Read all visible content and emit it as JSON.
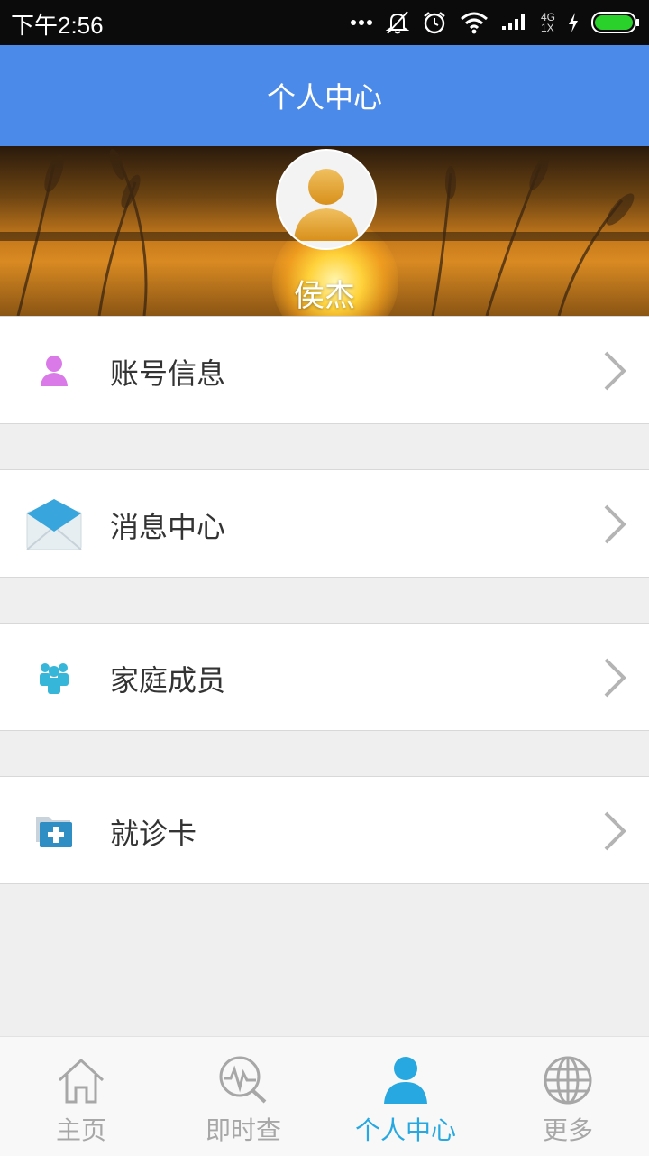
{
  "status_bar": {
    "time": "下午2:56",
    "network_top": "4G",
    "network_bottom": "1X"
  },
  "header": {
    "title": "个人中心"
  },
  "profile": {
    "name": "侯杰"
  },
  "menu": [
    {
      "label": "账号信息",
      "icon": "user-icon"
    },
    {
      "label": "消息中心",
      "icon": "envelope-icon"
    },
    {
      "label": "家庭成员",
      "icon": "family-icon"
    },
    {
      "label": "就诊卡",
      "icon": "medical-folder-icon"
    }
  ],
  "tabs": [
    {
      "label": "主页",
      "icon": "home-icon",
      "active": false
    },
    {
      "label": "即时查",
      "icon": "monitor-search-icon",
      "active": false
    },
    {
      "label": "个人中心",
      "icon": "person-icon",
      "active": true
    },
    {
      "label": "更多",
      "icon": "globe-icon",
      "active": false
    }
  ],
  "colors": {
    "header": "#4b8ae8",
    "active_tab": "#27a8e0",
    "inactive_tab": "#a7a7a7"
  }
}
